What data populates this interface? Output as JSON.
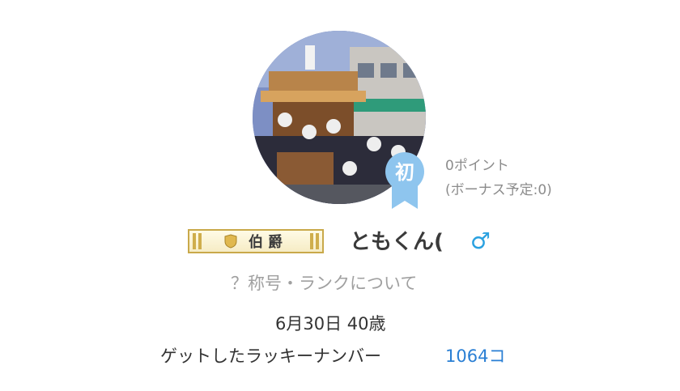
{
  "profile": {
    "avatar_icon": "profile-photo-festival-float",
    "beginner_badge": "初",
    "points": "0ポイント",
    "bonus_pending": "(ボーナス予定:0)",
    "rank_title": "伯爵",
    "username": "ともくん(",
    "gender_symbol": "♂",
    "rank_info_link": "？称号・ランクについて",
    "birthday_age": "6月30日 40歳",
    "lucky_number_label": "ゲットしたラッキーナンバー",
    "lucky_number_count": "1064コ"
  },
  "colors": {
    "badge_blue": "#8ec5ee",
    "gender_blue": "#2aa1e0",
    "link_blue": "#2a7fd4",
    "rank_gold": "#cfae4c"
  }
}
